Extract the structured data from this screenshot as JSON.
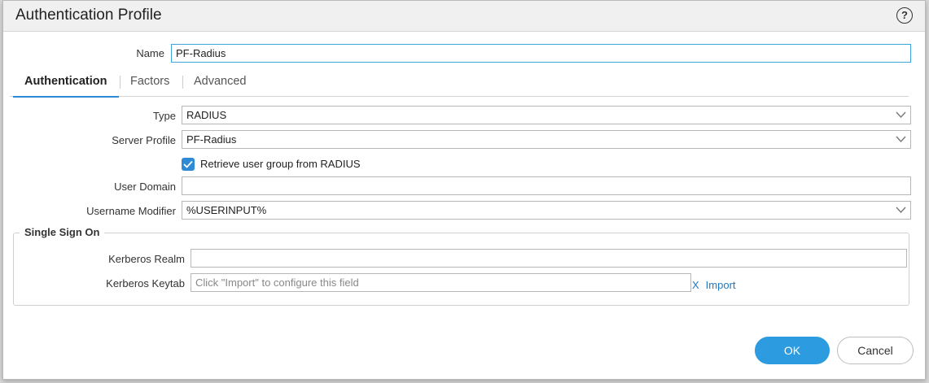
{
  "dialog": {
    "title": "Authentication Profile",
    "help_icon": "help-icon",
    "help_glyph": "?"
  },
  "form": {
    "name_label": "Name",
    "name_value": "PF-Radius"
  },
  "tabs": [
    {
      "label": "Authentication",
      "active": true
    },
    {
      "label": "Factors",
      "active": false
    },
    {
      "label": "Advanced",
      "active": false
    }
  ],
  "auth": {
    "type_label": "Type",
    "type_value": "RADIUS",
    "server_profile_label": "Server Profile",
    "server_profile_value": "PF-Radius",
    "retrieve_group_label": "Retrieve user group from RADIUS",
    "retrieve_group_checked": true,
    "user_domain_label": "User Domain",
    "user_domain_value": "",
    "username_modifier_label": "Username Modifier",
    "username_modifier_value": "%USERINPUT%"
  },
  "sso": {
    "legend": "Single Sign On",
    "kerberos_realm_label": "Kerberos Realm",
    "kerberos_realm_value": "",
    "kerberos_keytab_label": "Kerberos Keytab",
    "kerberos_keytab_placeholder": "Click \"Import\" to configure this field",
    "import_x": "X",
    "import_label": "Import"
  },
  "buttons": {
    "ok_label": "OK",
    "cancel_label": "Cancel"
  },
  "colors": {
    "accent": "#2d9be0",
    "link": "#1f7ac2",
    "focus_border": "#3da5de"
  }
}
